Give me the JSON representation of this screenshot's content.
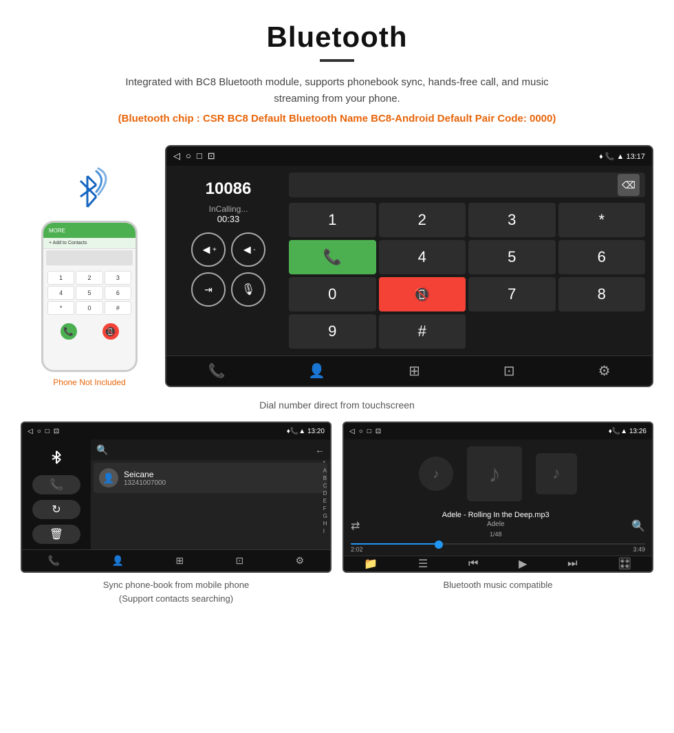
{
  "header": {
    "title": "Bluetooth",
    "description": "Integrated with BC8 Bluetooth module, supports phonebook sync, hands-free call, and music streaming from your phone.",
    "highlight": "(Bluetooth chip : CSR BC8    Default Bluetooth Name BC8-Android    Default Pair Code: 0000)"
  },
  "phone_area": {
    "not_included_label": "Phone Not Included"
  },
  "call_screen": {
    "statusbar_time": "13:17",
    "call_number": "10086",
    "call_status": "InCalling...",
    "call_timer": "00:33",
    "dialpad_keys": [
      "1",
      "2",
      "3",
      "*",
      "4",
      "5",
      "6",
      "0",
      "7",
      "8",
      "9",
      "#"
    ],
    "caption": "Dial number direct from touchscreen"
  },
  "contacts_screen": {
    "statusbar_time": "13:20",
    "contact_name": "Seicane",
    "contact_number": "13241007000",
    "alphabet": [
      "*",
      "A",
      "B",
      "C",
      "D",
      "E",
      "F",
      "G",
      "H",
      "I"
    ],
    "search_placeholder": "Search"
  },
  "music_screen": {
    "statusbar_time": "13:26",
    "track_name": "Adele - Rolling In the Deep.mp3",
    "artist": "Adele",
    "track_count": "1/48",
    "time_current": "2:02",
    "time_total": "3:49"
  },
  "captions": {
    "dial": "Dial number direct from touchscreen",
    "contacts": "Sync phone-book from mobile phone\n(Support contacts searching)",
    "music": "Bluetooth music compatible"
  },
  "icons": {
    "back": "◁",
    "home": "○",
    "recents": "□",
    "vol_up": "◄+",
    "vol_down": "◄-",
    "transfer": "⇥",
    "mic": "🎤",
    "phone_dial": "📞",
    "contacts": "👤",
    "keypad": "⊞",
    "export": "📤",
    "settings": "⚙",
    "bt": "✱",
    "search": "🔍",
    "shuffle": "⇄",
    "folder": "📁",
    "list": "☰",
    "prev": "⏮",
    "play": "▶",
    "next": "⏭",
    "eq": "🎛"
  }
}
